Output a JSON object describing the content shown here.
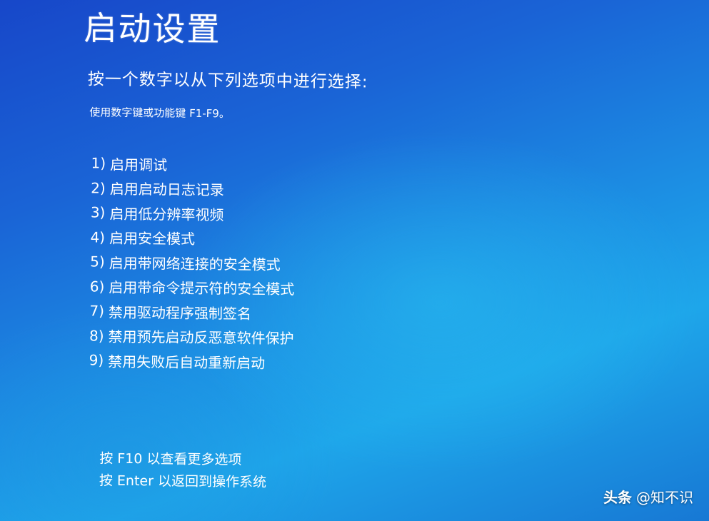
{
  "screen": {
    "title": "启动设置",
    "subtitle": "按一个数字以从下列选项中进行选择:",
    "hint": "使用数字键或功能键 F1-F9。",
    "options": [
      {
        "num": "1)",
        "label": "启用调试"
      },
      {
        "num": "2)",
        "label": "启用启动日志记录"
      },
      {
        "num": "3)",
        "label": "启用低分辨率视频"
      },
      {
        "num": "4)",
        "label": "启用安全模式"
      },
      {
        "num": "5)",
        "label": "启用带网络连接的安全模式"
      },
      {
        "num": "6)",
        "label": "启用带命令提示符的安全模式"
      },
      {
        "num": "7)",
        "label": "禁用驱动程序强制签名"
      },
      {
        "num": "8)",
        "label": "禁用预先启动反恶意软件保护"
      },
      {
        "num": "9)",
        "label": "禁用失败后自动重新启动"
      }
    ],
    "footer": {
      "more_options": "按 F10 以查看更多选项",
      "return_os": "按 Enter 以返回到操作系统"
    }
  },
  "watermark": {
    "brand": "头条",
    "handle": "@知不识"
  },
  "colors": {
    "background_top": "#1747c9",
    "background_glow": "#1ea6ea",
    "text": "#ffffff"
  }
}
